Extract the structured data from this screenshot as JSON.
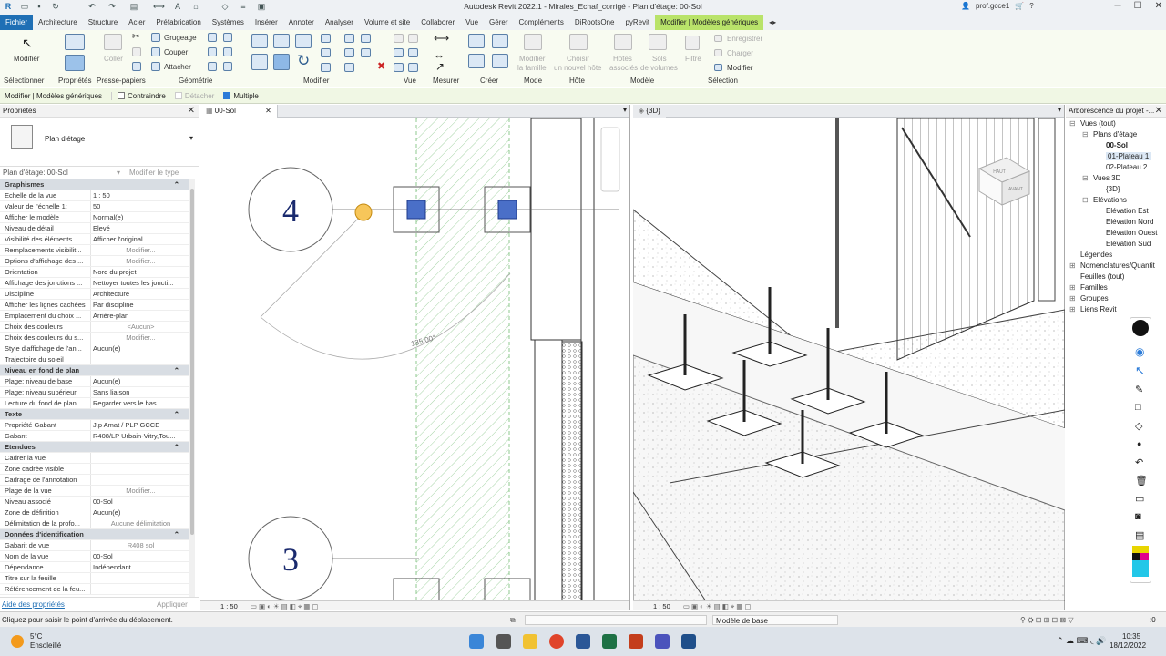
{
  "title_bar": {
    "title": "Autodesk Revit 2022.1 - Mirales_Echaf_corrigé - Plan d'étage: 00-Sol",
    "user": "prof.gcce1"
  },
  "menu": {
    "items": [
      "Fichier",
      "Architecture",
      "Structure",
      "Acier",
      "Préfabrication",
      "Systèmes",
      "Insérer",
      "Annoter",
      "Analyser",
      "Volume et site",
      "Collaborer",
      "Vue",
      "Gérer",
      "Compléments",
      "DiRootsOne",
      "pyRevit",
      "Modifier | Modèles génériques"
    ]
  },
  "ribbon": {
    "modify_label": "Modifier",
    "paste_label": "Coller",
    "grugeage": "Grugeage",
    "couper": "Couper",
    "attacher": "Attacher",
    "mod_famille_1": "Modifier",
    "mod_famille_2": "la famille",
    "choisir_1": "Choisir",
    "choisir_2": "un nouvel hôte",
    "hotes_1": "Hôtes",
    "hotes_2": "associés",
    "sols_1": "Sols",
    "sols_2": "de volumes",
    "filtre": "Filtre",
    "enregistrer": "Enregistrer",
    "charger": "Charger",
    "modifier_sel": "Modifier",
    "groups": [
      "Sélectionner",
      "Propriétés",
      "Presse-papiers",
      "Géométrie",
      "Modifier",
      "Vue",
      "Mesurer",
      "Créer",
      "Mode",
      "Hôte",
      "Modèle",
      "Sélection"
    ]
  },
  "options_bar": {
    "context": "Modifier | Modèles génériques",
    "contraindre": "Contraindre",
    "detacher": "Détacher",
    "multiple": "Multiple"
  },
  "properties": {
    "title": "Propriétés",
    "type_name": "Plan d'étage",
    "filter": "Plan d'étage: 00-Sol",
    "edit_type": "Modifier le type",
    "help": "Aide des propriétés",
    "apply": "Appliquer",
    "rows": [
      {
        "k": "Graphismes",
        "sec": true
      },
      {
        "k": "Echelle de la vue",
        "v": "1 : 50"
      },
      {
        "k": "Valeur de l'échelle    1:",
        "v": "50"
      },
      {
        "k": "Afficher le modèle",
        "v": "Normal(e)"
      },
      {
        "k": "Niveau de détail",
        "v": "Elevé"
      },
      {
        "k": "Visibilité des éléments",
        "v": "Afficher l'original"
      },
      {
        "k": "Remplacements visibilit...",
        "v": "Modifier...",
        "btn": true
      },
      {
        "k": "Options d'affichage des ...",
        "v": "Modifier...",
        "btn": true
      },
      {
        "k": "Orientation",
        "v": "Nord du projet"
      },
      {
        "k": "Affichage des jonctions ...",
        "v": "Nettoyer toutes les joncti..."
      },
      {
        "k": "Discipline",
        "v": "Architecture"
      },
      {
        "k": "Afficher les lignes cachées",
        "v": "Par discipline"
      },
      {
        "k": "Emplacement du choix ...",
        "v": "Arrière-plan"
      },
      {
        "k": "Choix des couleurs",
        "v": "<Aucun>",
        "btn": true
      },
      {
        "k": "Choix des couleurs du s...",
        "v": "Modifier...",
        "btn": true
      },
      {
        "k": "Style d'affichage de l'an...",
        "v": "Aucun(e)"
      },
      {
        "k": "Trajectoire du soleil",
        "v": ""
      },
      {
        "k": "Niveau en fond de plan",
        "sec": true
      },
      {
        "k": "Plage: niveau de base",
        "v": "Aucun(e)"
      },
      {
        "k": "Plage: niveau supérieur",
        "v": "Sans liaison"
      },
      {
        "k": "Lecture du fond de plan",
        "v": "Regarder vers le bas"
      },
      {
        "k": "Texte",
        "sec": true
      },
      {
        "k": "Propriété Gabant",
        "v": "J.p Amat / PLP GCCE"
      },
      {
        "k": "Gabant",
        "v": "R408/LP Urbain-Vitry,Tou..."
      },
      {
        "k": "Etendues",
        "sec": true
      },
      {
        "k": "Cadrer la vue",
        "v": ""
      },
      {
        "k": "Zone cadrée visible",
        "v": ""
      },
      {
        "k": "Cadrage de l'annotation",
        "v": ""
      },
      {
        "k": "Plage de la vue",
        "v": "Modifier...",
        "btn": true
      },
      {
        "k": "Niveau associé",
        "v": "00-Sol"
      },
      {
        "k": "Zone de définition",
        "v": "Aucun(e)"
      },
      {
        "k": "Délimitation de la profo...",
        "v": "Aucune délimitation",
        "btn": true
      },
      {
        "k": "Données d'identification",
        "sec": true
      },
      {
        "k": "Gabarit de vue",
        "v": "R408 sol",
        "btn": true
      },
      {
        "k": "Nom de la vue",
        "v": "00-Sol"
      },
      {
        "k": "Dépendance",
        "v": "Indépendant"
      },
      {
        "k": "Titre sur la feuille",
        "v": ""
      },
      {
        "k": "Référencement de la feu...",
        "v": ""
      }
    ]
  },
  "plan_view": {
    "tab": "00-Sol",
    "grid_a": "4",
    "grid_b": "3",
    "angle": "135.00°",
    "scale": "1 : 50"
  },
  "view_3d": {
    "tab": "{3D}",
    "scale": "1 : 50",
    "cube_top": "HAUT",
    "cube_front": "AVANT"
  },
  "browser": {
    "title": "Arborescence du projet -...",
    "items": [
      {
        "t": "Vues (tout)"
      },
      {
        "t": "Plans d'étage"
      },
      {
        "t": "00-Sol",
        "bold": true
      },
      {
        "t": "01-Plateau 1",
        "sel": true
      },
      {
        "t": "02-Plateau 2"
      },
      {
        "t": "Vues 3D"
      },
      {
        "t": "{3D}"
      },
      {
        "t": "Elévations"
      },
      {
        "t": "Elévation Est"
      },
      {
        "t": "Elévation Nord"
      },
      {
        "t": "Elévation Ouest"
      },
      {
        "t": "Elévation Sud"
      },
      {
        "t": "Légendes"
      },
      {
        "t": "Nomenclatures/Quantit"
      },
      {
        "t": "Feuilles (tout)"
      },
      {
        "t": "Familles"
      },
      {
        "t": "Groupes"
      },
      {
        "t": "Liens Revit"
      }
    ]
  },
  "status": {
    "message": "Cliquez pour saisir le point d'arrivée du déplacement.",
    "model": "Modèle de base",
    "filter_count": ":0"
  },
  "taskbar": {
    "weather_temp": "5°C",
    "weather_desc": "Ensoleillé",
    "time": "10:35",
    "date": "18/12/2022"
  }
}
